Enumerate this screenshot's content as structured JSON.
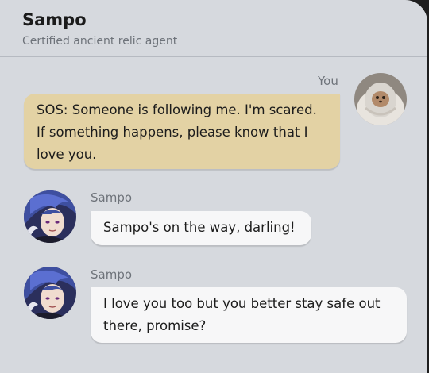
{
  "header": {
    "title": "Sampo",
    "subtitle": "Certified ancient relic agent"
  },
  "messages": [
    {
      "sender": "You",
      "text": "SOS: Someone is following me. I'm scared. If something happens, please know that I love you."
    },
    {
      "sender": "Sampo",
      "text": "Sampo's on the way, darling!"
    },
    {
      "sender": "Sampo",
      "text": "I love you too but you better stay safe out there, promise?"
    }
  ],
  "colors": {
    "background": "#d6d9de",
    "my_bubble": "#e3d2a4",
    "their_bubble": "#f7f7f8"
  },
  "icons": {
    "user_avatar": "cat-in-blanket-avatar",
    "contact_avatar": "sampo-portrait-avatar"
  }
}
